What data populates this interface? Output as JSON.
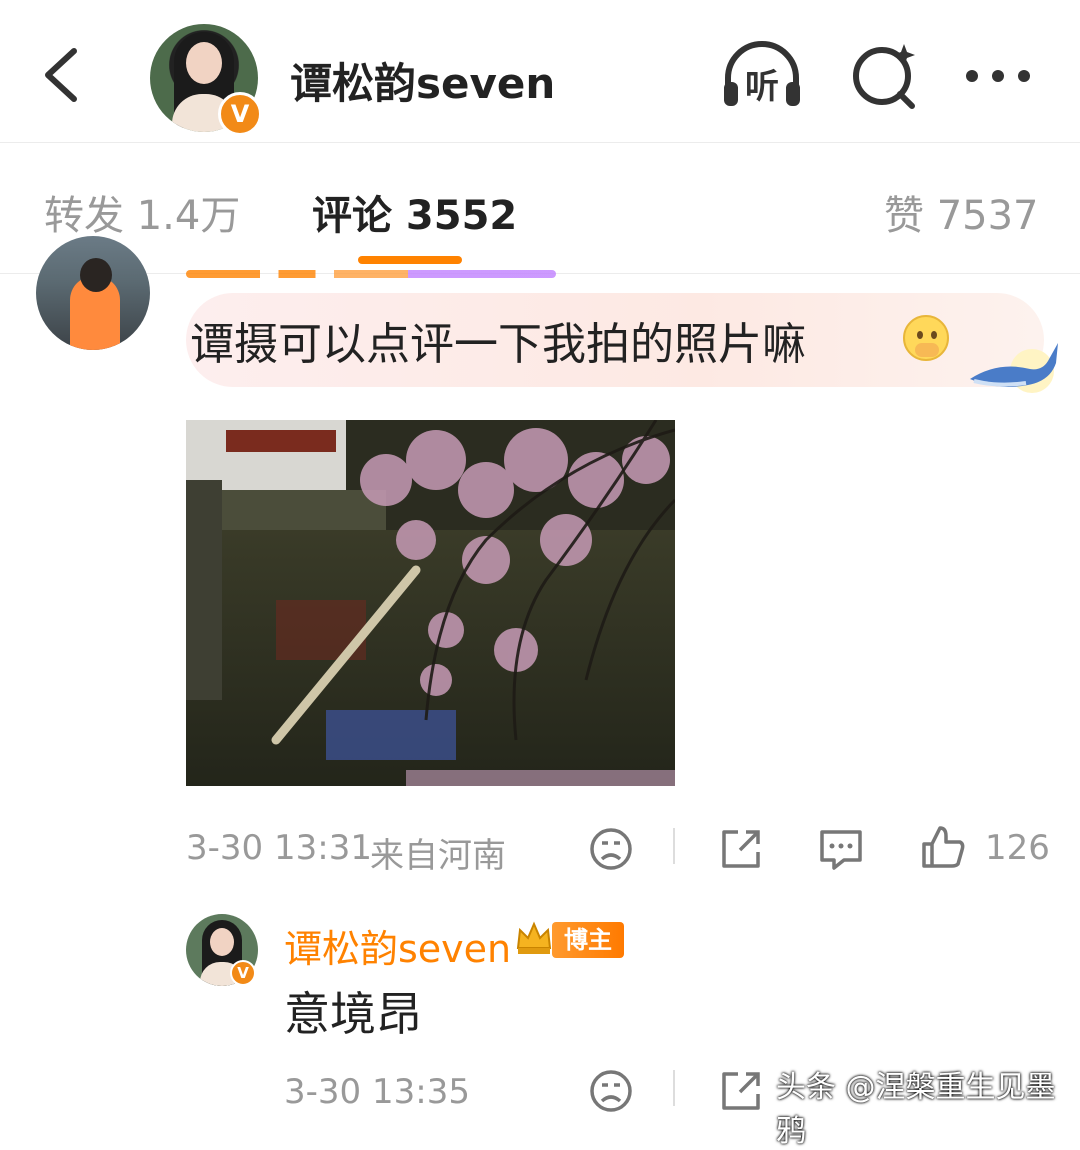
{
  "header": {
    "title": "谭松韵seven",
    "verified_badge": "V",
    "icons": [
      "back-icon",
      "listen-icon",
      "search-icon",
      "more-icon"
    ],
    "listen_label": "听"
  },
  "tabs": [
    {
      "label": "转发 1.4万"
    },
    {
      "label": "评论 3552"
    },
    {
      "label": "赞 7537"
    }
  ],
  "comment": {
    "text": "谭摄可以点评一下我拍的照片嘛",
    "time": "3-30 13:31",
    "location": "来自河南",
    "likes": "126",
    "accent_color": "#ff8200"
  },
  "reply": {
    "name": "谭松韵seven",
    "badge": "博主",
    "text": "意境昂",
    "time": "3-30 13:35"
  },
  "watermark": "头条 @涅槃重生见墨鸦"
}
